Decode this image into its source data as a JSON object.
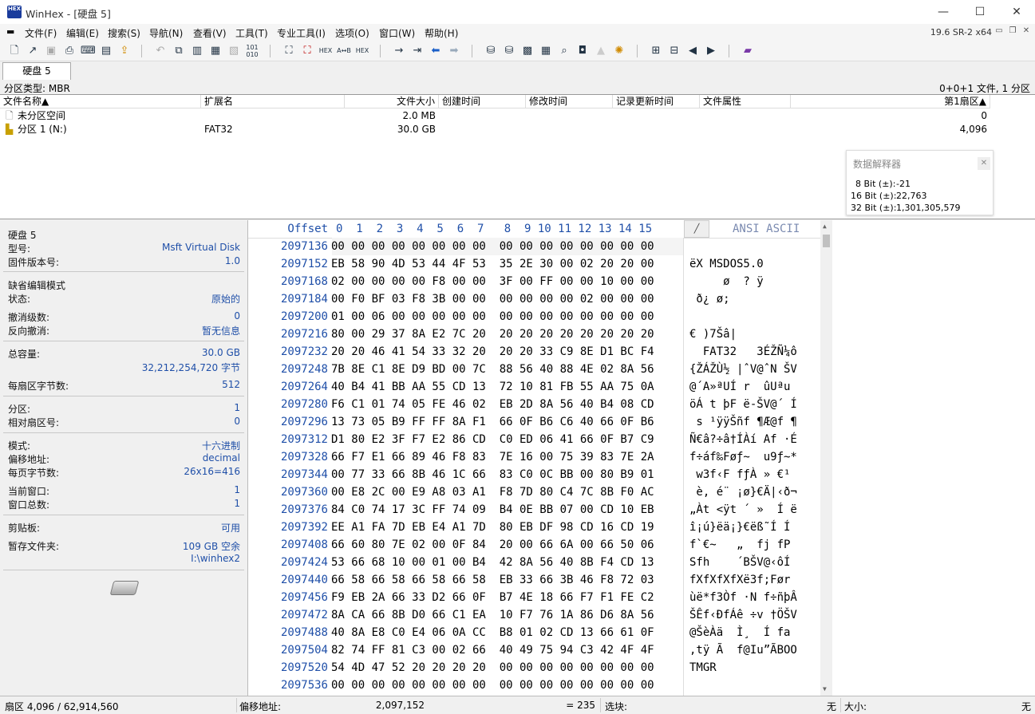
{
  "window": {
    "title": "WinHex - [硬盘 5]",
    "logo_text": "HEX",
    "version": "19.6 SR-2 x64",
    "controls": {
      "minimize": "—",
      "maximize": "☐",
      "close": "✕"
    }
  },
  "menu": [
    "文件(F)",
    "编辑(E)",
    "搜索(S)",
    "导航(N)",
    "查看(V)",
    "工具(T)",
    "专业工具(I)",
    "选项(O)",
    "窗口(W)",
    "帮助(H)"
  ],
  "tab": {
    "label": "硬盘 5"
  },
  "partition_info": {
    "left": "分区类型: MBR",
    "right": "0+0+1 文件, 1 分区"
  },
  "filelist": {
    "headers": {
      "name": "文件名称▲",
      "ext": "扩展名",
      "size": "文件大小",
      "created": "创建时间",
      "modified": "修改时间",
      "recorded": "记录更新时间",
      "attrs": "文件属性",
      "first_sector": "第1扇区▲"
    },
    "rows": [
      {
        "name": "未分区空间",
        "ext": "",
        "size": "2.0 MB",
        "first_sector": "0"
      },
      {
        "name": "分区 1 (N:)",
        "ext": "FAT32",
        "size": "30.0 GB",
        "first_sector": "4,096"
      }
    ]
  },
  "interpreter": {
    "title": "数据解释器",
    "rows": [
      {
        "label": "8 Bit (±):",
        "value": "-21"
      },
      {
        "label": "16 Bit (±):",
        "value": "22,763"
      },
      {
        "label": "32 Bit (±):",
        "value": "1,301,305,579"
      }
    ]
  },
  "left_panel": {
    "disk_name": "硬盘 5",
    "model_label": "型号:",
    "model_value": "Msft Virtual Disk",
    "firmware_label": "固件版本号:",
    "firmware_value": "1.0",
    "edit_mode_label": "缺省编辑模式",
    "state_label": "状态:",
    "state_value": "原始的",
    "undo_level_label": "撤消级数:",
    "undo_level_value": "0",
    "reverse_undo_label": "反向撤消:",
    "reverse_undo_value": "暂无信息",
    "capacity_label": "总容量:",
    "capacity_value": "30.0 GB",
    "capacity_bytes": "32,212,254,720 字节",
    "bytes_per_sector_label": "每扇区字节数:",
    "bytes_per_sector_value": "512",
    "partition_label": "分区:",
    "partition_value": "1",
    "rel_sector_label": "相对扇区号:",
    "rel_sector_value": "0",
    "mode_label": "模式:",
    "mode_value": "十六进制",
    "offset_addr_label": "偏移地址:",
    "offset_addr_value": "decimal",
    "bytes_per_page_label": "每页字节数:",
    "bytes_per_page_value": "26x16=416",
    "current_window_label": "当前窗口:",
    "current_window_value": "1",
    "total_windows_label": "窗口总数:",
    "total_windows_value": "1",
    "clipboard_label": "剪贴板:",
    "clipboard_value": "可用",
    "temp_folder_label": "暂存文件夹:",
    "temp_folder_value": "109 GB 空余",
    "temp_folder_path": "I:\\winhex2"
  },
  "hex": {
    "offset_header": "Offset",
    "col_header": "0  1  2  3  4  5  6  7   8  9 10 11 12 13 14 15",
    "ascii_header": "ANSI ASCII",
    "rows": [
      {
        "off": "2097136",
        "hex": "00 00 00 00 00 00 00 00  00 00 00 00 00 00 00 00",
        "ascii": ""
      },
      {
        "off": "2097152",
        "hex": "EB 58 90 4D 53 44 4F 53  35 2E 30 00 02 20 20 00",
        "ascii": "ëX MSDOS5.0"
      },
      {
        "off": "2097168",
        "hex": "02 00 00 00 00 F8 00 00  3F 00 FF 00 00 10 00 00",
        "ascii": "     ø  ? ÿ"
      },
      {
        "off": "2097184",
        "hex": "00 F0 BF 03 F8 3B 00 00  00 00 00 00 02 00 00 00",
        "ascii": " ð¿ ø;"
      },
      {
        "off": "2097200",
        "hex": "01 00 06 00 00 00 00 00  00 00 00 00 00 00 00 00",
        "ascii": ""
      },
      {
        "off": "2097216",
        "hex": "80 00 29 37 8A E2 7C 20  20 20 20 20 20 20 20 20",
        "ascii": "€ )7Šâ|"
      },
      {
        "off": "2097232",
        "hex": "20 20 46 41 54 33 32 20  20 20 33 C9 8E D1 BC F4",
        "ascii": "  FAT32   3ÉŽÑ¼ô"
      },
      {
        "off": "2097248",
        "hex": "7B 8E C1 8E D9 BD 00 7C  88 56 40 88 4E 02 8A 56",
        "ascii": "{ŽÁŽÙ½ |ˆV@ˆN ŠV"
      },
      {
        "off": "2097264",
        "hex": "40 B4 41 BB AA 55 CD 13  72 10 81 FB 55 AA 75 0A",
        "ascii": "@´A»ªUÍ r  ûUªu"
      },
      {
        "off": "2097280",
        "hex": "F6 C1 01 74 05 FE 46 02  EB 2D 8A 56 40 B4 08 CD",
        "ascii": "öÁ t þF ë-ŠV@´ Í"
      },
      {
        "off": "2097296",
        "hex": "13 73 05 B9 FF FF 8A F1  66 0F B6 C6 40 66 0F B6",
        "ascii": " s ¹ÿÿŠñf ¶Æ@f ¶"
      },
      {
        "off": "2097312",
        "hex": "D1 80 E2 3F F7 E2 86 CD  C0 ED 06 41 66 0F B7 C9",
        "ascii": "Ñ€â?÷â†ÍÀí Af ·É"
      },
      {
        "off": "2097328",
        "hex": "66 F7 E1 66 89 46 F8 83  7E 16 00 75 39 83 7E 2A",
        "ascii": "f÷áf‰Føƒ~  u9ƒ~*"
      },
      {
        "off": "2097344",
        "hex": "00 77 33 66 8B 46 1C 66  83 C0 0C BB 00 80 B9 01",
        "ascii": " w3f‹F fƒÀ » €¹"
      },
      {
        "off": "2097360",
        "hex": "00 E8 2C 00 E9 A8 03 A1  F8 7D 80 C4 7C 8B F0 AC",
        "ascii": " è, é¨ ¡ø}€Ä|‹ð¬"
      },
      {
        "off": "2097376",
        "hex": "84 C0 74 17 3C FF 74 09  B4 0E BB 07 00 CD 10 EB",
        "ascii": "„Àt <ÿt ´ »  Í ë"
      },
      {
        "off": "2097392",
        "hex": "EE A1 FA 7D EB E4 A1 7D  80 EB DF 98 CD 16 CD 19",
        "ascii": "î¡ú}ëä¡}€ëß˜Í Í"
      },
      {
        "off": "2097408",
        "hex": "66 60 80 7E 02 00 0F 84  20 00 66 6A 00 66 50 06",
        "ascii": "f`€~   „  fj fP"
      },
      {
        "off": "2097424",
        "hex": "53 66 68 10 00 01 00 B4  42 8A 56 40 8B F4 CD 13",
        "ascii": "Sfh    ´BŠV@‹ôÍ"
      },
      {
        "off": "2097440",
        "hex": "66 58 66 58 66 58 66 58  EB 33 66 3B 46 F8 72 03",
        "ascii": "fXfXfXfXë3f;Før"
      },
      {
        "off": "2097456",
        "hex": "F9 EB 2A 66 33 D2 66 0F  B7 4E 18 66 F7 F1 FE C2",
        "ascii": "ùë*f3Òf ·N f÷ñþÂ"
      },
      {
        "off": "2097472",
        "hex": "8A CA 66 8B D0 66 C1 EA  10 F7 76 1A 86 D6 8A 56",
        "ascii": "ŠÊf‹ÐfÁê ÷v †ÖŠV"
      },
      {
        "off": "2097488",
        "hex": "40 8A E8 C0 E4 06 0A CC  B8 01 02 CD 13 66 61 0F",
        "ascii": "@ŠèÀä  Ì¸  Í fa"
      },
      {
        "off": "2097504",
        "hex": "82 74 FF 81 C3 00 02 66  40 49 75 94 C3 42 4F 4F",
        "ascii": "‚tÿ Ã  f@Iu”ÃBOO"
      },
      {
        "off": "2097520",
        "hex": "54 4D 47 52 20 20 20 20  00 00 00 00 00 00 00 00",
        "ascii": "TMGR"
      },
      {
        "off": "2097536",
        "hex": "00 00 00 00 00 00 00 00  00 00 00 00 00 00 00 00",
        "ascii": ""
      }
    ]
  },
  "status": {
    "sector": "扇区 4,096 / 62,914,560",
    "offset_label": "偏移地址:",
    "offset_value": "2,097,152",
    "value": "= 235",
    "selection_label": "选块:",
    "selection_value": "无",
    "size_label": "大小:",
    "size_value": "无"
  }
}
